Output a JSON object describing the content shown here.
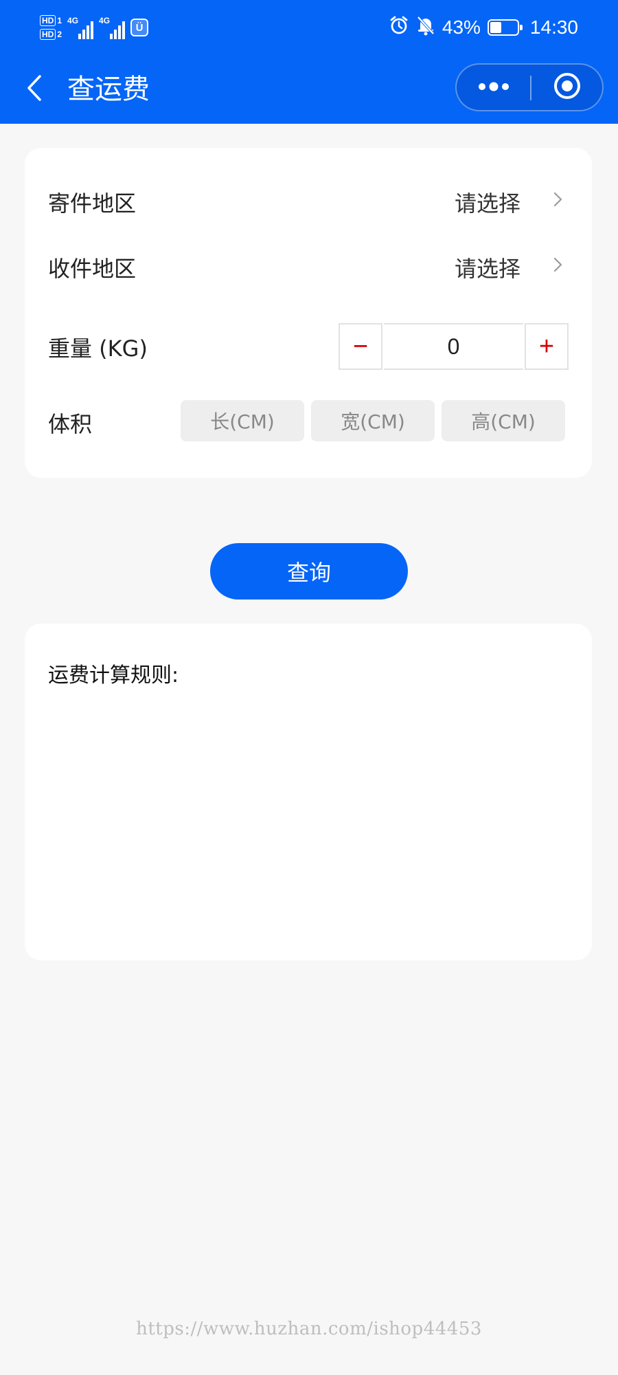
{
  "status_bar": {
    "hd1": "HD",
    "hd1_num": "1",
    "hd2": "HD",
    "hd2_num": "2",
    "net1": "4G",
    "net2": "4G",
    "app_badge": "Ü",
    "battery_percent": "43%",
    "battery_level": 0.43,
    "time": "14:30",
    "icons": [
      "alarm-icon",
      "bell-muted-icon",
      "battery-icon"
    ]
  },
  "nav": {
    "title": "查运费",
    "back_icon": "chevron-left-icon",
    "more_icon": "more-dots-icon",
    "close_icon": "target-circle-icon"
  },
  "form": {
    "sender_label": "寄件地区",
    "sender_value": "请选择",
    "receiver_label": "收件地区",
    "receiver_value": "请选择",
    "weight_label": "重量 (KG)",
    "weight_minus": "−",
    "weight_value": "0",
    "weight_plus": "+",
    "volume_label": "体积",
    "length_placeholder": "长(CM)",
    "width_placeholder": "宽(CM)",
    "height_placeholder": "高(CM)"
  },
  "query_button": "查询",
  "rules": {
    "title": "运费计算规则:"
  },
  "watermark": "https://www.huzhan.com/ishop44453",
  "colors": {
    "brand": "#0565f7",
    "stepper_accent": "#d60000",
    "page_bg": "#f7f7f7"
  }
}
